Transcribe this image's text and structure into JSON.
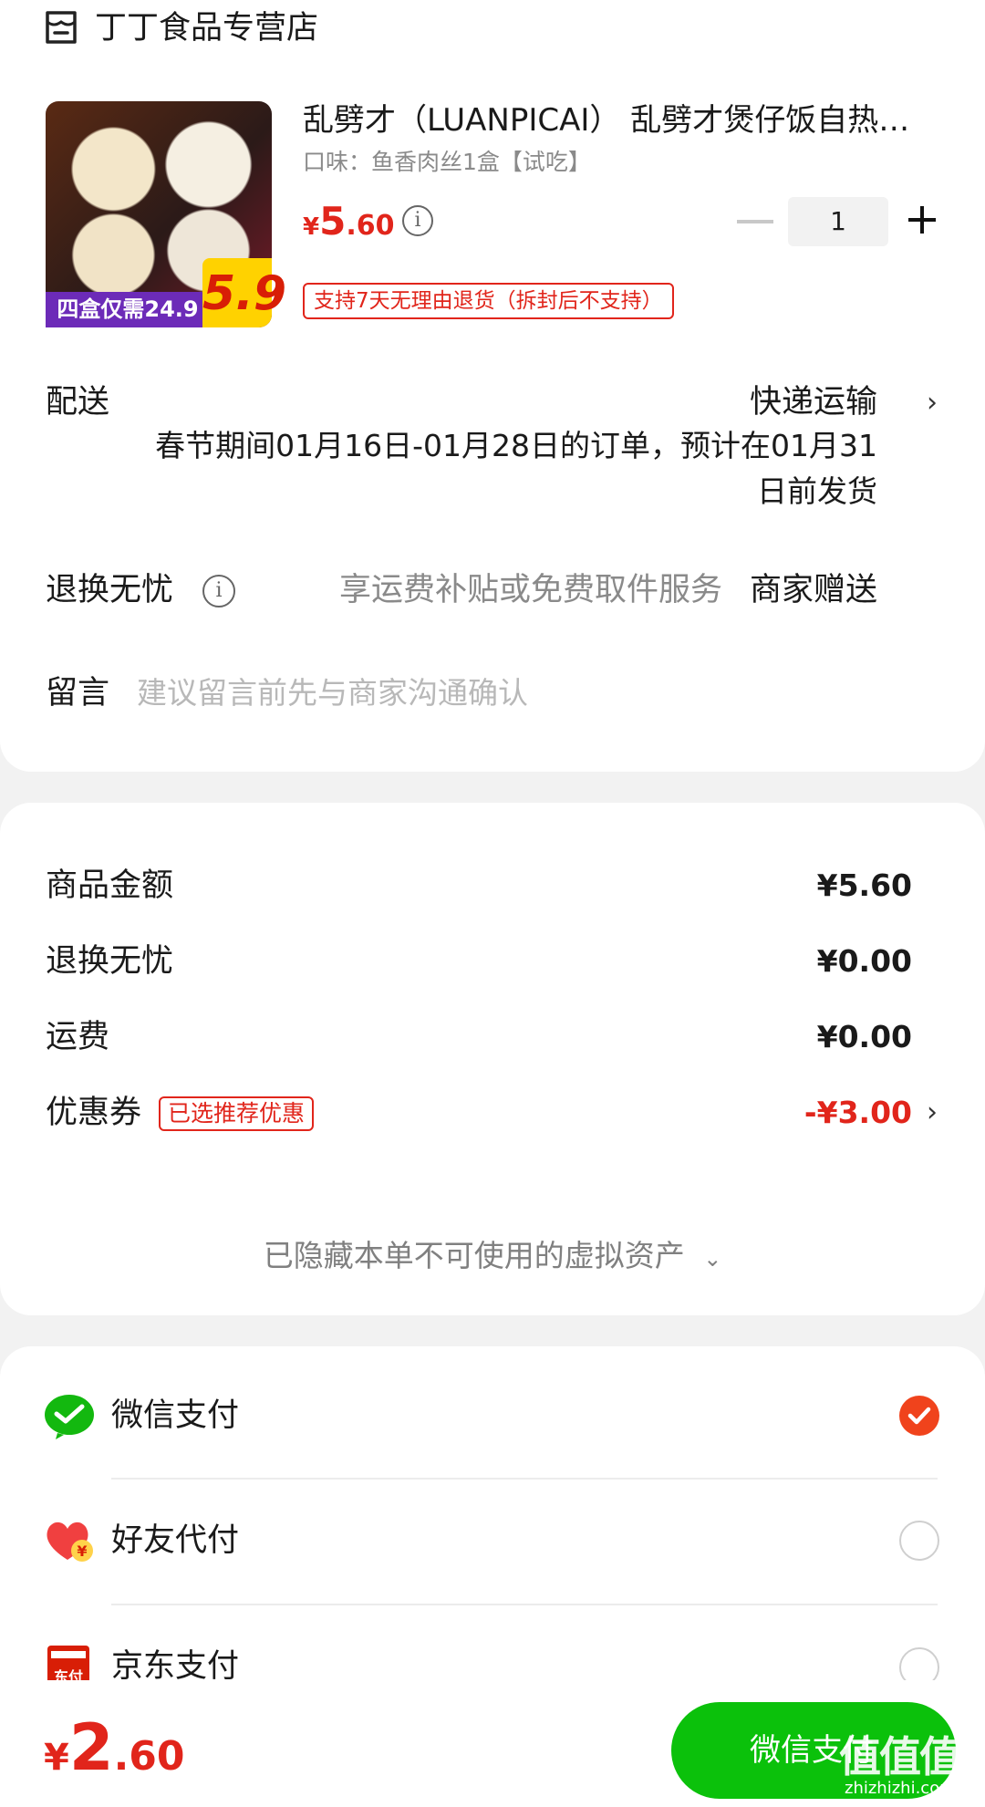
{
  "store": {
    "name": "丁丁食品专营店",
    "icon": "store-icon"
  },
  "product": {
    "title": "乱劈才（LUANPICAI） 乱劈才煲仔饭自热…",
    "spec": "口味：鱼香肉丝1盒【试吃】",
    "price": {
      "currency": "¥",
      "integer": "5",
      "decimal": ".60"
    },
    "quantity": "1",
    "return_tag": "支持7天无理由退货（拆封后不支持）",
    "image_promo_left": "四盒仅需24.9",
    "image_promo_right": "5.9"
  },
  "delivery": {
    "label": "配送",
    "method": "快递运输",
    "note": "春节期间01月16日-01月28日的订单，预计在01月31日前发货"
  },
  "worry_free": {
    "label": "退换无忧",
    "desc": "享运费补贴或免费取件服务",
    "value": "商家赠送"
  },
  "message": {
    "label": "留言",
    "placeholder": "建议留言前先与商家沟通确认"
  },
  "summary": {
    "rows": [
      {
        "label": "商品金额",
        "value": "¥5.60"
      },
      {
        "label": "退换无忧",
        "value": "¥0.00"
      },
      {
        "label": "运费",
        "value": "¥0.00"
      }
    ],
    "coupon": {
      "label": "优惠券",
      "badge": "已选推荐优惠",
      "value": "-¥3.00"
    },
    "hidden_assets": "已隐藏本单不可使用的虚拟资产"
  },
  "payment": {
    "methods": [
      {
        "name": "微信支付",
        "icon": "wechat-pay-icon",
        "selected": true
      },
      {
        "name": "好友代付",
        "icon": "friend-pay-icon",
        "selected": false
      },
      {
        "name": "京东支付",
        "icon": "jd-pay-icon",
        "selected": false
      }
    ]
  },
  "footer": {
    "total": {
      "currency": "¥",
      "integer": "2",
      "decimal": ".60"
    },
    "pay_button": "微信支付",
    "watermark": "值值值",
    "watermark_url": "zhizhizhi.com"
  },
  "colors": {
    "accent_red": "#e1251b",
    "wechat_green": "#0bc10b",
    "radio_selected": "#f0431c"
  }
}
